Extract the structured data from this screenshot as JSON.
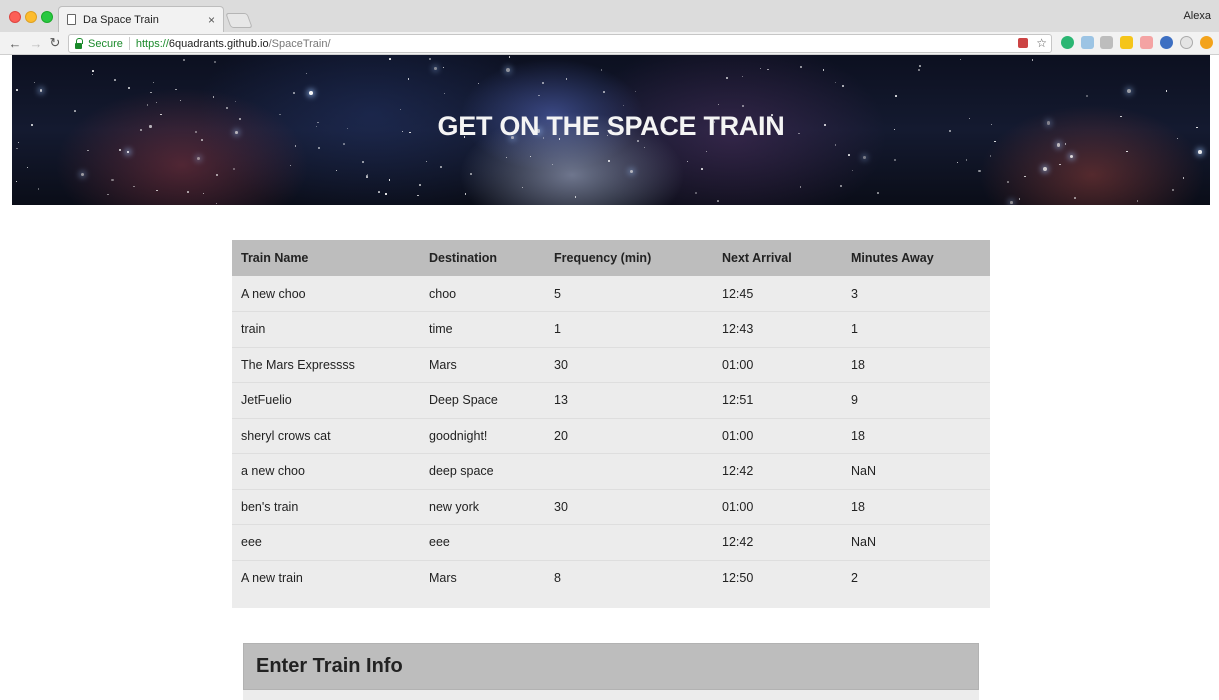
{
  "browser": {
    "tab_title": "Da Space Train",
    "tab_close": "×",
    "user": "Alexa",
    "secure_label": "Secure",
    "url_scheme": "https://",
    "url_host": "6quadrants.github.io",
    "url_path": "/SpaceTrain/",
    "back": "←",
    "forward": "→",
    "reload": "↻",
    "star": "☆"
  },
  "hero": {
    "title": "GET ON THE SPACE TRAIN"
  },
  "schedule": {
    "columns": [
      "Train Name",
      "Destination",
      "Frequency (min)",
      "Next Arrival",
      "Minutes Away"
    ],
    "rows": [
      [
        "A new choo",
        "choo",
        "5",
        "12:45",
        "3"
      ],
      [
        "train",
        "time",
        "1",
        "12:43",
        "1"
      ],
      [
        "The Mars Expressss",
        "Mars",
        "30",
        "01:00",
        "18"
      ],
      [
        "JetFuelio",
        "Deep Space",
        "13",
        "12:51",
        "9"
      ],
      [
        "sheryl crows cat",
        "goodnight!",
        "20",
        "01:00",
        "18"
      ],
      [
        "a new choo",
        "deep space",
        "",
        "12:42",
        "NaN"
      ],
      [
        "ben's train",
        "new york",
        "30",
        "01:00",
        "18"
      ],
      [
        "eee",
        "eee",
        "",
        "12:42",
        "NaN"
      ],
      [
        "A new train",
        "Mars",
        "8",
        "12:50",
        "2"
      ]
    ]
  },
  "form": {
    "title": "Enter Train Info"
  }
}
